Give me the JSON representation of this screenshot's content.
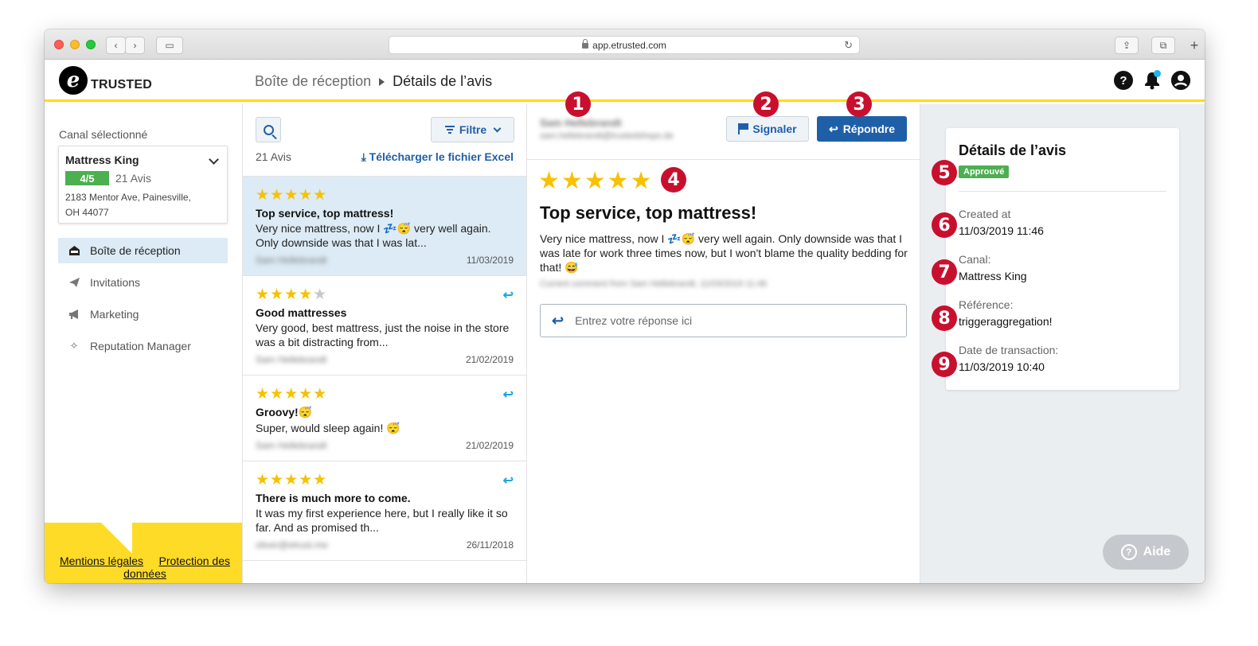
{
  "browser": {
    "url": "app.etrusted.com"
  },
  "header": {
    "logo_letter": "e",
    "logo_text": "TRUSTED",
    "breadcrumb": [
      "Boîte de réception",
      "Détails de l’avis"
    ],
    "help_glyph": "?"
  },
  "sidebar": {
    "channel_label": "Canal sélectionné",
    "channel": {
      "name": "Mattress King",
      "rating": "4/5",
      "reviews": "21 Avis",
      "address_1": "2183 Mentor Ave, Painesville,",
      "address_2": "OH 44077"
    },
    "nav": [
      {
        "label": "Boîte de réception",
        "icon": "inbox-icon"
      },
      {
        "label": "Invitations",
        "icon": "paper-plane-icon"
      },
      {
        "label": "Marketing",
        "icon": "megaphone-icon"
      },
      {
        "label": "Reputation Manager",
        "icon": "sparkle-icon"
      }
    ],
    "footer": {
      "legal": "Mentions légales",
      "privacy": "Protection des données"
    }
  },
  "list": {
    "filter_label": "Filtre",
    "count": "21 Avis",
    "excel_label": "Télécharger le fichier Excel",
    "reviews": [
      {
        "stars": "★★★★★",
        "stars_off": "",
        "title": "Top service, top mattress!",
        "body": "Very nice mattress, now I 💤😴 very well again. Only downside was that I was lat...",
        "author": "Sam Hellebrandt",
        "date": "11/03/2019"
      },
      {
        "stars": "★★★★",
        "stars_off": "★",
        "title": "Good mattresses",
        "body": "Very good, best mattress, just the noise in the store was a bit distracting from...",
        "author": "Sam Hellebrandt",
        "date": "21/02/2019"
      },
      {
        "stars": "★★★★★",
        "stars_off": "",
        "title": "Groovy!😴",
        "body": "Super, would sleep again! 😴",
        "author": "Sam Hellebrandt",
        "date": "21/02/2019"
      },
      {
        "stars": "★★★★★",
        "stars_off": "",
        "title": "There is much more to come.",
        "body": "It was my first experience here, but I really like it so far. And as promised th...",
        "author": "oliver@etrust.me",
        "date": "26/11/2018"
      }
    ]
  },
  "detail": {
    "author": "Sam Hellebrandt",
    "email": "sam.hellebrandt@trustedshops.de",
    "signal_label": "Signaler",
    "reply_label": "Répondre",
    "stars": "★★★★★",
    "title": "Top service, top mattress!",
    "body": "Very nice mattress, now I 💤😴 very well again. Only downside was that I was late for work three times now, but I won't blame the quality bedding for that! 😅",
    "comment_meta": "Current comment from Sam Hellebrandt, 11/03/2019 11:46",
    "reply_placeholder": "Entrez votre réponse ici"
  },
  "details_card": {
    "title": "Détails de l’avis",
    "status": "Approuvé",
    "created_label": "Created at",
    "created_value": "11/03/2019 11:46",
    "canal_label": "Canal:",
    "canal_value": "Mattress King",
    "ref_label": "Référence:",
    "ref_value": "triggeraggregation!",
    "date_label": "Date de transaction:",
    "date_value": "11/03/2019 10:40"
  },
  "aide_label": "Aide",
  "markers": [
    "1",
    "2",
    "3",
    "4",
    "5",
    "6",
    "7",
    "8",
    "9"
  ],
  "colors": {
    "accent_yellow": "#ffdc0f",
    "brand_blue": "#1f5fa8",
    "marker_red": "#c8102e",
    "approved_green": "#4caf50",
    "star": "#f7c100"
  }
}
